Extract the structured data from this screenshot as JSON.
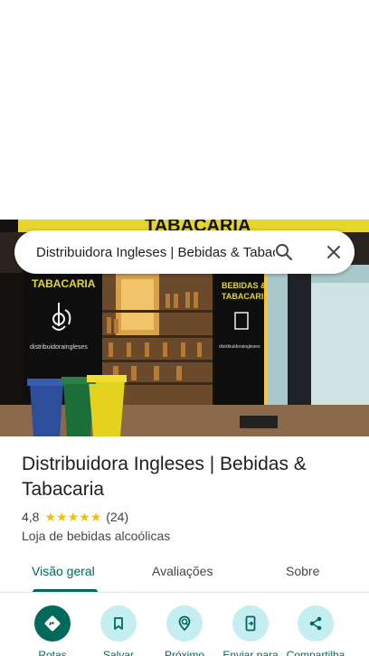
{
  "search": {
    "query": "Distribuidora Ingleses | Bebidas & Tabacaria"
  },
  "hero": {
    "sign_top": "TABACARIA",
    "sign_left": "TABACARIA",
    "sign_right_1": "BEBIDAS &",
    "sign_right_2": "TABACARIA",
    "brand_text": "distribuidoraingleses",
    "brand_text_right": "distribuidoraingleses"
  },
  "place": {
    "title": "Distribuidora Ingleses | Bebidas & Tabacaria",
    "rating": "4,8",
    "stars": "★★★★★",
    "review_count": "(24)",
    "category": "Loja de bebidas alcoólicas"
  },
  "tabs": [
    {
      "label": "Visão geral",
      "active": true
    },
    {
      "label": "Avaliações",
      "active": false
    },
    {
      "label": "Sobre",
      "active": false
    }
  ],
  "actions": [
    {
      "label": "Rotas",
      "icon": "directions-icon"
    },
    {
      "label": "Salvar",
      "icon": "bookmark-icon"
    },
    {
      "label": "Próximo",
      "icon": "nearby-icon"
    },
    {
      "label": "Enviar para",
      "icon": "send-to-phone-icon"
    },
    {
      "label": "Compartilha",
      "icon": "share-icon"
    }
  ],
  "colors": {
    "accent": "#00695c",
    "accent_light": "#c4eef0",
    "star": "#fbbc04"
  }
}
